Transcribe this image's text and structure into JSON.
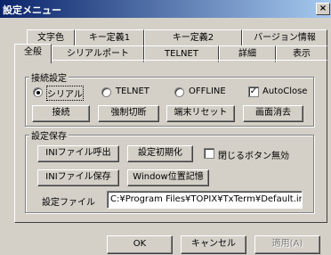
{
  "window": {
    "title": "設定メニュー",
    "close_glyph": "×"
  },
  "tabs_back": [
    "文字色",
    "キー定義1",
    "キー定義2",
    "バージョン情報"
  ],
  "tabs_front": [
    "全般",
    "シリアルポート",
    "TELNET",
    "詳細",
    "表示"
  ],
  "active_tab": "全般",
  "connection": {
    "legend": "接続設定",
    "radios": [
      {
        "label": "シリアル",
        "selected": true
      },
      {
        "label": "TELNET",
        "selected": false
      },
      {
        "label": "OFFLINE",
        "selected": false
      }
    ],
    "auto_close": {
      "label": "AutoClose",
      "checked": true,
      "mark": "✓"
    },
    "buttons": [
      "接続",
      "強制切断",
      "端末リセット",
      "画面消去"
    ]
  },
  "save": {
    "legend": "設定保存",
    "load_ini": "INIファイル呼出",
    "init_settings": "設定初期化",
    "disable_close": {
      "label": "閉じるボタン無効",
      "checked": false
    },
    "save_ini": "INIファイル保存",
    "remember_pos": "Window位置記憶",
    "file_label": "設定ファイル",
    "file_path": "C:¥Program Files¥TOPIX¥TxTerm¥Default.ini"
  },
  "footer": {
    "ok": "OK",
    "cancel": "キャンセル",
    "apply": "適用(A)"
  }
}
